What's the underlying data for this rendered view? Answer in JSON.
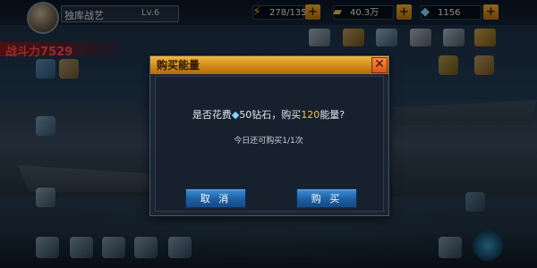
{
  "player": {
    "name": "独库战艺",
    "level": "Lv.6",
    "power_label": "战斗力",
    "power_value": "7529"
  },
  "resources": [
    {
      "icon": "lightning-icon",
      "value": "278/135"
    },
    {
      "icon": "gold-bars-icon",
      "value": "40.3万"
    },
    {
      "icon": "diamond-icon",
      "value": "1156"
    }
  ],
  "dialog": {
    "title": "购买能量",
    "message_prefix": "是否花费",
    "diamond_amount": "50钻石",
    "message_mid": "，购买",
    "energy_amount": "120",
    "message_suffix": "能量?",
    "sub_text": "今日还可购买1/1次",
    "cancel_label": "取 消",
    "confirm_label": "购 买"
  },
  "colors": {
    "header_orange": "#e0a12a",
    "button_blue": "#2a6fbf",
    "highlight": "#f5c33b",
    "power_red": "#ff4d4d"
  }
}
